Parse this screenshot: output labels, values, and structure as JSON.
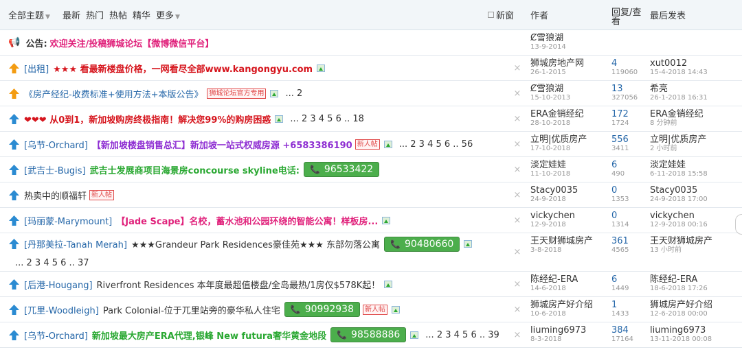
{
  "header": {
    "all_topics": "全部主题",
    "filters": [
      "最新",
      "热门",
      "热帖",
      "精华",
      "更多"
    ],
    "new_window": "新窗",
    "author": "作者",
    "reply_view": "回复/查看",
    "last_post": "最后发表"
  },
  "announcement": {
    "label": "公告:",
    "text": "欢迎关注/投稿狮城论坛【微博微信平台】",
    "author": "Ȼ雪狼湖",
    "date": "13-9-2014"
  },
  "rows": [
    {
      "cat": "[出租]",
      "title": "★★★ 看最新楼盘价格，一网看尽全部www.kangongyu.com",
      "style": "red",
      "img": true,
      "pages": "",
      "phone": "",
      "new": false,
      "author": "狮城房地产网",
      "date": "26-1-2015",
      "replies": "4",
      "views": "119060",
      "last": "xut0012",
      "last_date": "15-4-2018 14:43",
      "icon": "orange"
    },
    {
      "cat": "",
      "title": "《房产经纪-收费标准+使用方法+本版公告》",
      "style": "blue",
      "img": true,
      "pages": "... 2",
      "phone": "",
      "new": false,
      "badge": "狮城论坛官方专用",
      "author": "Ȼ雪狼湖",
      "date": "15-10-2013",
      "replies": "13",
      "views": "327056",
      "last": "希亮",
      "last_date": "26-1-2018 16:31",
      "icon": "orange"
    },
    {
      "cat": "",
      "title": "❤❤❤ 从0到1，新加坡购房终极指南！解决您99%的购房困惑",
      "style": "red",
      "img": true,
      "pages": "... 2 3 4 5 6 .. 18",
      "phone": "",
      "new": false,
      "author": "ERA金销经纪",
      "date": "28-10-2018",
      "replies": "172",
      "views": "1724",
      "last": "ERA金销经纪",
      "last_date": "8 分钟前",
      "icon": "blue"
    },
    {
      "cat": "[乌节-Orchard]",
      "title": "【新加坡楼盘销售总汇】新加坡一站式权威房源 +6583386190",
      "style": "purple",
      "img": true,
      "pages": "... 2 3 4 5 6 .. 56",
      "phone": "",
      "new": true,
      "author": "立明|优质房产",
      "date": "17-10-2018",
      "replies": "556",
      "views": "3411",
      "last": "立明|优质房产",
      "last_date": "2 小时前",
      "icon": "blue"
    },
    {
      "cat": "[武吉士-Bugis]",
      "title": "武吉士发展商项目海景房concourse skyline电话:",
      "style": "green",
      "img": false,
      "pages": "",
      "phone": "96533422",
      "new": false,
      "author": "淡定娃娃",
      "date": "11-10-2018",
      "replies": "6",
      "views": "490",
      "last": "淡定娃娃",
      "last_date": "6-11-2018 15:58",
      "icon": "blue"
    },
    {
      "cat": "",
      "title": "热卖中的顺福轩",
      "style": "dark",
      "img": false,
      "pages": "",
      "phone": "",
      "new": true,
      "author": "Stacy0035",
      "date": "24-9-2018",
      "replies": "0",
      "views": "1353",
      "last": "Stacy0035",
      "last_date": "24-9-2018 17:00",
      "icon": "blue"
    },
    {
      "cat": "[玛丽蒙-Marymount]",
      "title": "【Jade Scape】名校，蓄水池和公园环绕的智能公寓！样板房...",
      "style": "pink",
      "img": true,
      "pages": "",
      "phone": "",
      "new": false,
      "author": "vickychen",
      "date": "12-9-2018",
      "replies": "0",
      "views": "1314",
      "last": "vickychen",
      "last_date": "12-9-2018 00:16",
      "icon": "blue"
    },
    {
      "cat": "[丹那美拉-Tanah Merah]",
      "title": "★★★Grandeur Park Residences豪佳苑★★★ 东部勿落公寓",
      "style": "dark",
      "img": true,
      "pages": "... 2 3 4 5 6 .. 37",
      "phone": "90480660",
      "new": false,
      "tall": true,
      "author": "王天财狮城房产",
      "date": "3-8-2018",
      "replies": "361",
      "views": "4565",
      "last": "王天财狮城房产",
      "last_date": "13 小时前",
      "icon": "blue"
    },
    {
      "cat": "[后港-Hougang]",
      "title": "Riverfront Residences 本年度最超值楼盘/全岛最热/1房仅$578K起！",
      "style": "dark",
      "img": true,
      "pages": "",
      "phone": "",
      "new": false,
      "author": "陈经纪-ERA",
      "date": "14-6-2018",
      "replies": "6",
      "views": "1449",
      "last": "陈经纪-ERA",
      "last_date": "18-6-2018 17:26",
      "icon": "blue"
    },
    {
      "cat": "[兀里-Woodleigh]",
      "title": "Park Colonial-位于兀里站旁的豪华私人住宅",
      "style": "dark",
      "img": true,
      "pages": "",
      "phone": "90992938",
      "new": true,
      "author": "狮城房产好介绍",
      "date": "10-6-2018",
      "replies": "1",
      "views": "1433",
      "last": "狮城房产好介绍",
      "last_date": "12-6-2018 00:00",
      "icon": "blue"
    },
    {
      "cat": "[乌节-Orchard]",
      "title": "新加坡最大房产ERA代理,银峰 New futura奢华黄金地段",
      "style": "green",
      "img": true,
      "pages": "... 2 3 4 5 6 .. 39",
      "phone": "98588886",
      "new": false,
      "author": "liuming6973",
      "date": "8-3-2018",
      "replies": "384",
      "views": "17164",
      "last": "liuming6973",
      "last_date": "13-11-2018 00:08",
      "icon": "blue"
    }
  ],
  "new_badge": "新人帖",
  "close_mark": "×"
}
